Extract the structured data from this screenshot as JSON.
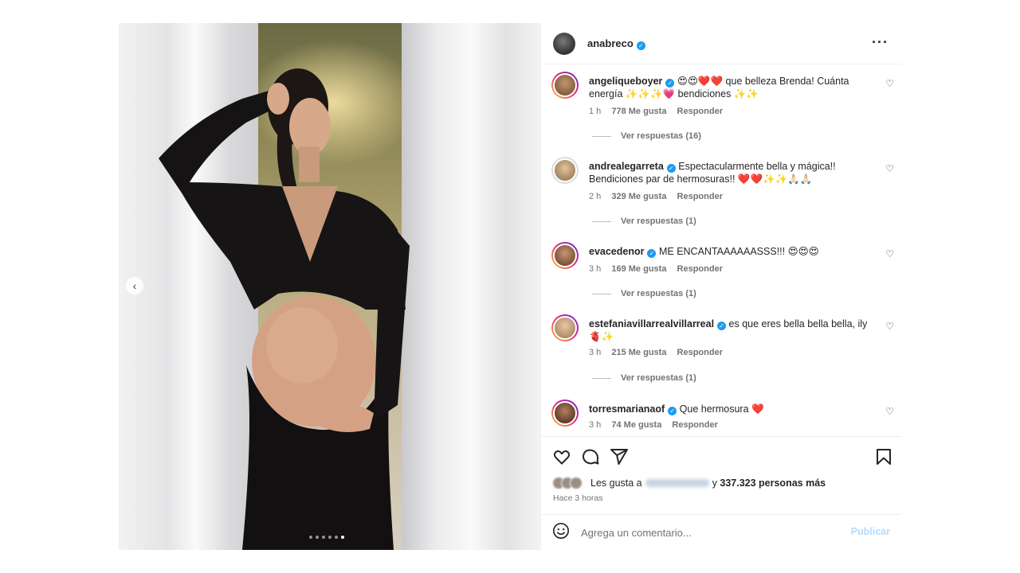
{
  "post": {
    "author": "anabreco",
    "carousel": {
      "slide_count": 6,
      "active_index": 5
    }
  },
  "comments": [
    {
      "username": "angeliqueboyer",
      "text_a": "😍😍❤️❤️ que belleza Brenda! Cuánta",
      "text_b": "energía ✨✨✨💗 bendiciones ✨✨",
      "time": "1 h",
      "likes": "778 Me gusta",
      "reply": "Responder",
      "replies": "Ver respuestas (16)"
    },
    {
      "username": "andrealegarreta",
      "text_a": "Espectacularmente bella y mágica!!",
      "text_b": "Bendiciones par de hermosuras!! ❤️❤️✨✨🙏🏻🙏🏻",
      "time": "2 h",
      "likes": "329 Me gusta",
      "reply": "Responder",
      "replies": "Ver respuestas (1)"
    },
    {
      "username": "evacedenor",
      "text_a": "ME ENCANTAAAAAASSS!!! 😍😍😍",
      "text_b": "",
      "time": "3 h",
      "likes": "169 Me gusta",
      "reply": "Responder",
      "replies": "Ver respuestas (1)"
    },
    {
      "username": "estefaniavillarrealvillarreal",
      "text_a": "es que eres bella bella bella, ily",
      "text_b": "🫀✨",
      "time": "3 h",
      "likes": "215 Me gusta",
      "reply": "Responder",
      "replies": "Ver respuestas (1)"
    },
    {
      "username": "torresmarianaof",
      "text_a": "Que hermosura ❤️",
      "text_b": "",
      "time": "3 h",
      "likes": "74 Me gusta",
      "reply": "Responder"
    }
  ],
  "likes": {
    "prefix": "Les gusta a",
    "conjunction": "y",
    "count_text": "337.323 personas más"
  },
  "timestamp": "Hace 3 horas",
  "add_comment": {
    "placeholder": "Agrega un comentario...",
    "publish_label": "Publicar"
  },
  "icons": {
    "more": "more-horizontal-icon",
    "like": "heart-icon",
    "comment": "comment-icon",
    "share": "share-icon",
    "save": "bookmark-icon",
    "emoji": "emoji-icon",
    "carousel_prev": "chevron-left-icon"
  },
  "colors": {
    "verified": "#1d9bf0",
    "publish_disabled": "#b3dbff",
    "muted_text": "#737373"
  }
}
